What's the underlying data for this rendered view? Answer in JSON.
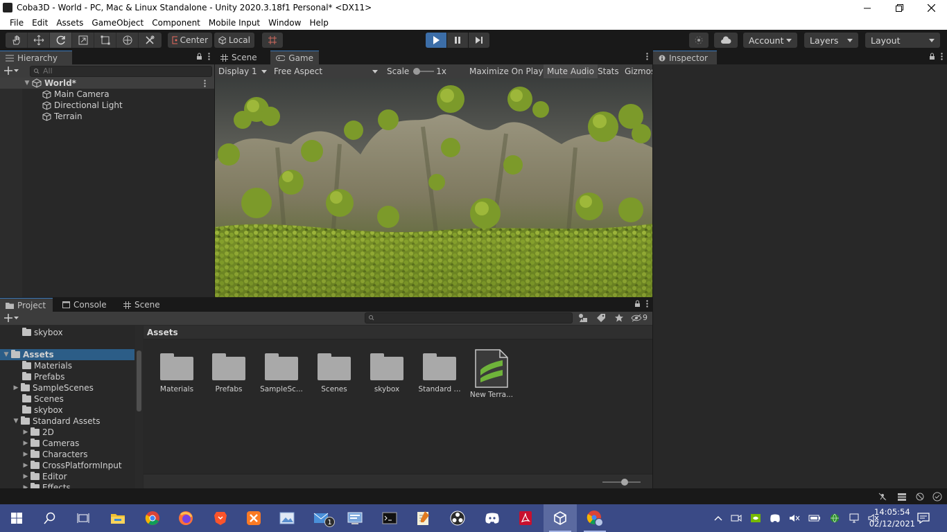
{
  "window": {
    "title": "Coba3D - World - PC, Mac & Linux Standalone - Unity 2020.3.18f1 Personal* <DX11>"
  },
  "menu": [
    "File",
    "Edit",
    "Assets",
    "GameObject",
    "Component",
    "Mobile Input",
    "Window",
    "Help"
  ],
  "toolbar": {
    "pivot_label": "Center",
    "space_label": "Local",
    "account_label": "Account",
    "layers_label": "Layers",
    "layout_label": "Layout"
  },
  "hierarchy": {
    "tab_label": "Hierarchy",
    "search_placeholder": "All",
    "scene_name": "World*",
    "objects": [
      "Main Camera",
      "Directional Light",
      "Terrain"
    ]
  },
  "game_view": {
    "tabs": [
      "Scene",
      "Game"
    ],
    "active_tab": "Game",
    "display_label": "Display 1",
    "aspect_label": "Free Aspect",
    "scale_label": "Scale",
    "scale_value": "1x",
    "maximize_label": "Maximize On Play",
    "mute_label": "Mute Audio",
    "stats_label": "Stats",
    "gizmos_label": "Gizmos"
  },
  "inspector": {
    "tab_label": "Inspector"
  },
  "project": {
    "tabs": [
      "Project",
      "Console",
      "Scene"
    ],
    "hidden_count": "9",
    "breadcrumb": "Assets",
    "tree": {
      "top_item": "skybox",
      "root": "Assets",
      "children": [
        "Materials",
        "Prefabs",
        "SampleScenes",
        "Scenes",
        "skybox",
        "Standard Assets"
      ],
      "standard_children": [
        "2D",
        "Cameras",
        "Characters",
        "CrossPlatformInput",
        "Editor",
        "Effects"
      ]
    },
    "assets": [
      "Materials",
      "Prefabs",
      "SampleSc...",
      "Scenes",
      "skybox",
      "Standard ...",
      "New Terra..."
    ]
  },
  "taskbar": {
    "time": "14:05:54",
    "date": "02/12/2021",
    "mail_badge": "1"
  },
  "colors": {
    "editor_bg": "#282828",
    "selection": "#2c5d87",
    "play_active": "#3c6ea8",
    "taskbar": "#3a4a86"
  }
}
